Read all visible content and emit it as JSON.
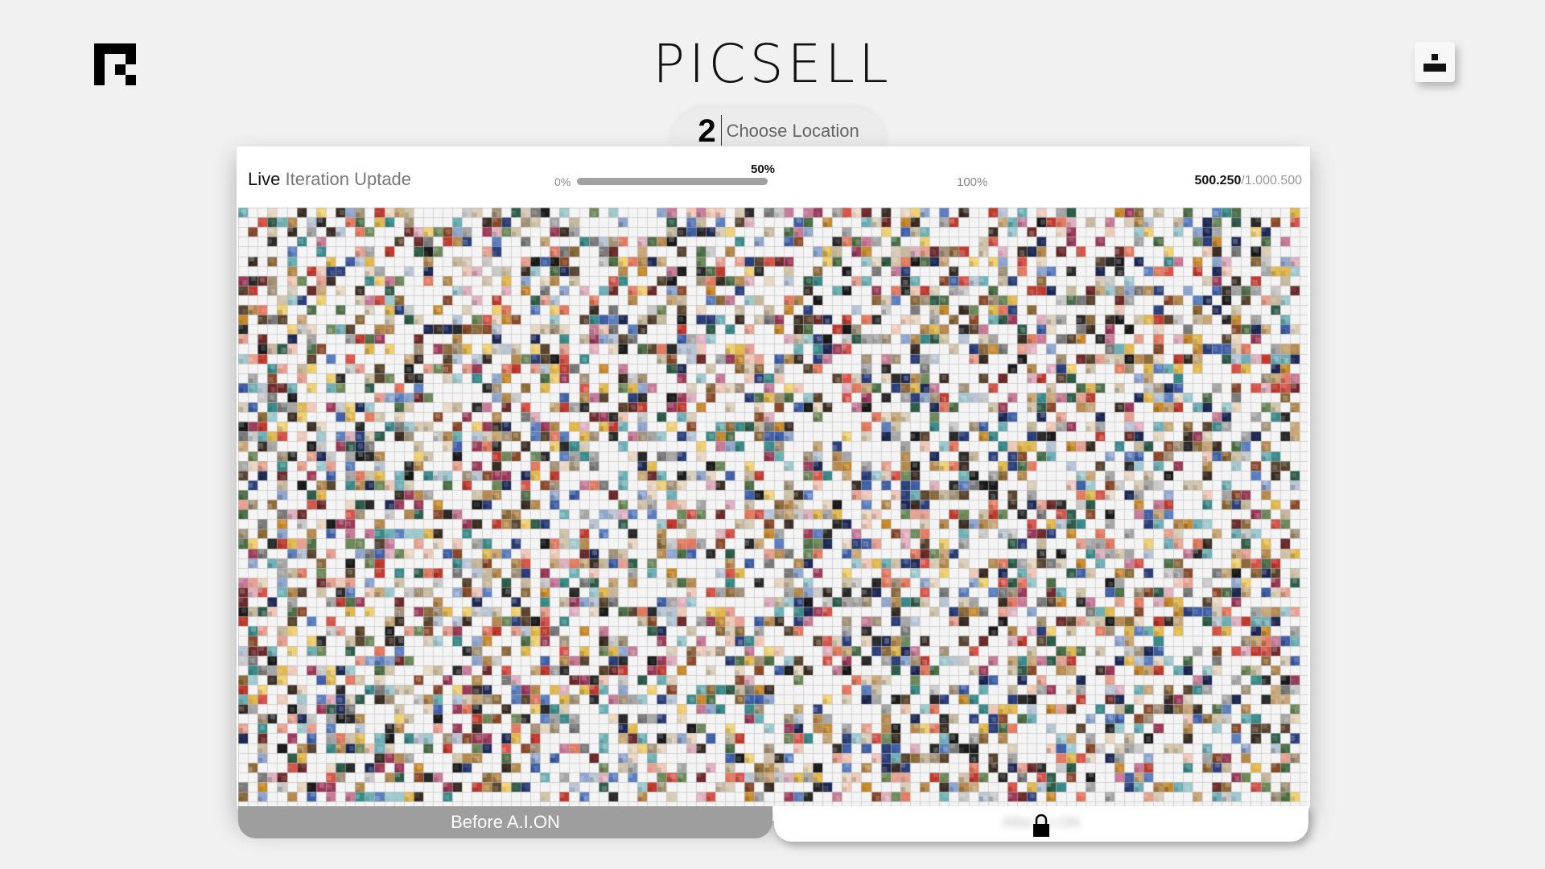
{
  "header": {
    "brand": "PICSELL",
    "logo_icon": "picsell-logo-icon",
    "user_icon": "user-icon"
  },
  "step": {
    "number": "2",
    "label": "Choose Location"
  },
  "panel": {
    "title_strong": "Live",
    "title_light": "Iteration Uptade",
    "progress": {
      "start_label": "0%",
      "mid_label": "50%",
      "end_label": "100%",
      "value": 0.5
    },
    "counter_current": "500.250",
    "counter_total": "/1.000.500"
  },
  "mosaic": {
    "fill_ratio": 0.5,
    "colors": [
      "#1e2a55",
      "#2c3f7a",
      "#3f5fa8",
      "#5c7fc0",
      "#8fa6cf",
      "#b8c5d6",
      "#d0c3a8",
      "#c9a777",
      "#b68a4e",
      "#8c6a3a",
      "#5a4630",
      "#3b2e24",
      "#1a1a1a",
      "#2a2a2a",
      "#c13a2e",
      "#d8544a",
      "#e57a60",
      "#e8a090",
      "#f0c8b8",
      "#e9d7c2",
      "#d9cdb8",
      "#c6b89c",
      "#a39278",
      "#6f8a5a",
      "#4e7048",
      "#2f5d4a",
      "#3a8a8a",
      "#6db0b6",
      "#9dc9cf",
      "#e2b84a",
      "#f0d070",
      "#c78a2c",
      "#8a4a2a",
      "#6d2b2b",
      "#9c3a5a",
      "#c87a98",
      "#e0b0c0",
      "#7a7a7a",
      "#a5a5a5",
      "#c9c9c9"
    ]
  },
  "footer": {
    "before_label": "Before A.I.ON",
    "after_label": "After A.I.ON",
    "lock_icon": "lock-icon"
  }
}
